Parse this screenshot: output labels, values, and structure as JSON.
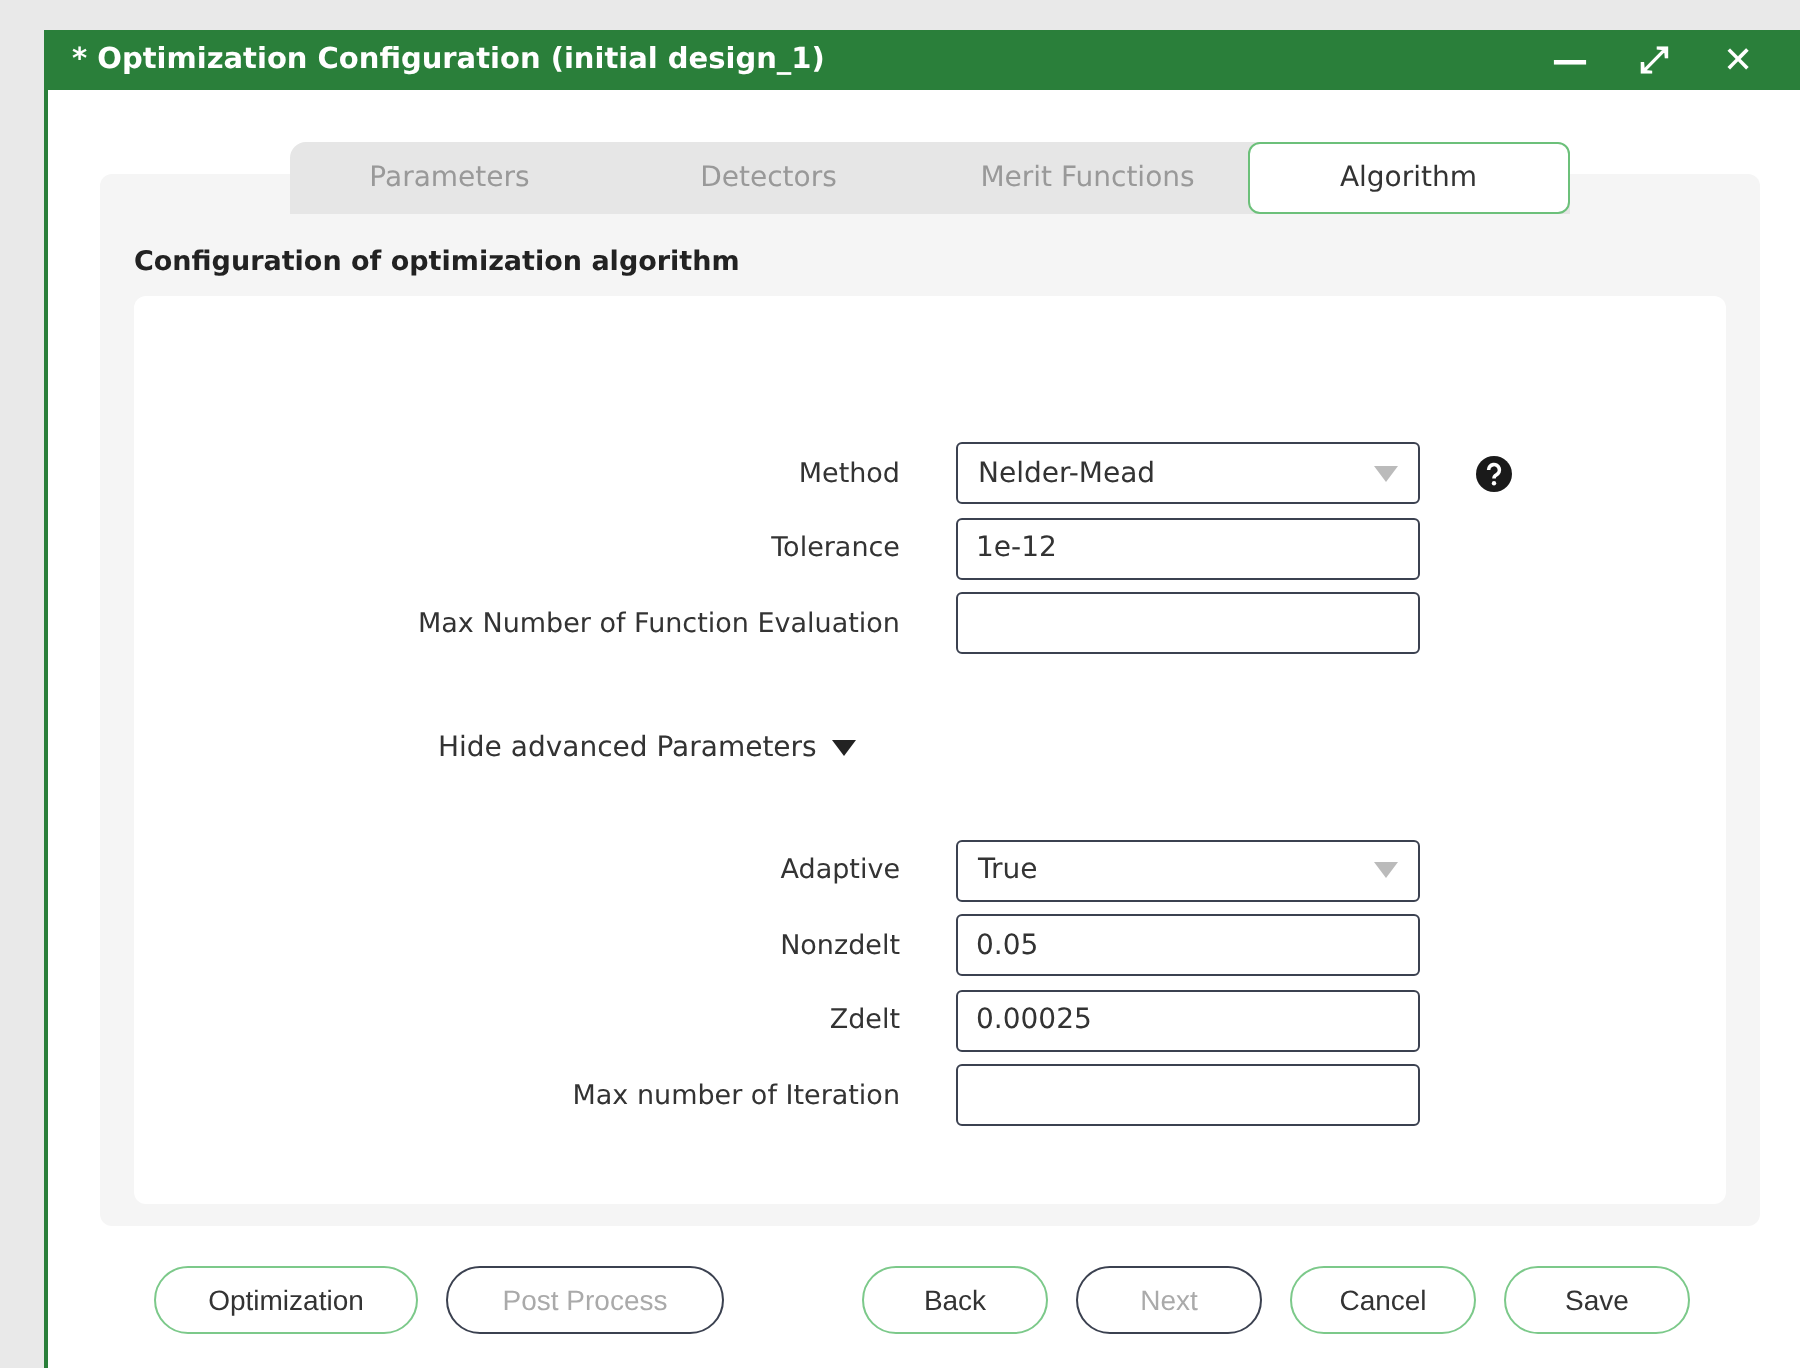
{
  "window": {
    "title": "* Optimization Configuration (initial design_1)",
    "controls": [
      "—",
      "⤢",
      "✕"
    ]
  },
  "tabs": [
    {
      "label": "Parameters",
      "selected": false
    },
    {
      "label": "Detectors",
      "selected": false
    },
    {
      "label": "Merit Functions",
      "selected": false
    },
    {
      "label": "Algorithm",
      "selected": true
    }
  ],
  "section_title": "Configuration of optimization algorithm",
  "fields": [
    {
      "label": "Method",
      "kind": "select",
      "value": "Nelder-Mead",
      "help": true
    },
    {
      "label": "Tolerance",
      "kind": "text",
      "value": "1e-12"
    },
    {
      "label": "Max Number of Function Evaluation",
      "kind": "text"
    }
  ],
  "advanced_toggle": {
    "label": "Hide advanced Parameters",
    "expanded": true
  },
  "advanced_fields": [
    {
      "label": "Adaptive",
      "kind": "select",
      "value": "True"
    },
    {
      "label": "Nonzdelt",
      "kind": "text",
      "value": "0.05"
    },
    {
      "label": "Zdelt",
      "kind": "text",
      "value": "0.00025"
    },
    {
      "label": "Max number of Iteration",
      "kind": "text"
    }
  ],
  "left_buttons": [
    {
      "label": "Optimization",
      "disabled": false
    },
    {
      "label": "Post Process",
      "disabled": true
    }
  ],
  "right_buttons": [
    {
      "label": "Back",
      "disabled": false
    },
    {
      "label": "Next",
      "disabled": true
    },
    {
      "label": "Cancel",
      "disabled": false
    },
    {
      "label": "Save",
      "disabled": false
    }
  ]
}
